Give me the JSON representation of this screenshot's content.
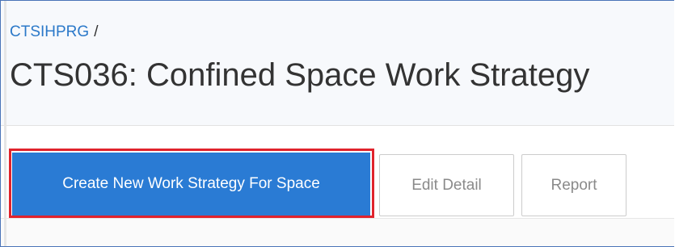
{
  "breadcrumb": {
    "parent_label": "CTSIHPRG",
    "separator": "/"
  },
  "page": {
    "title": "CTS036: Confined Space Work Strategy"
  },
  "toolbar": {
    "create_label": "Create New Work Strategy For Space",
    "edit_label": "Edit Detail",
    "report_label": "Report"
  },
  "colors": {
    "primary": "#2a7bd4",
    "highlight": "#e0232c",
    "link": "#2b79c9",
    "frame": "#4a74b8"
  }
}
